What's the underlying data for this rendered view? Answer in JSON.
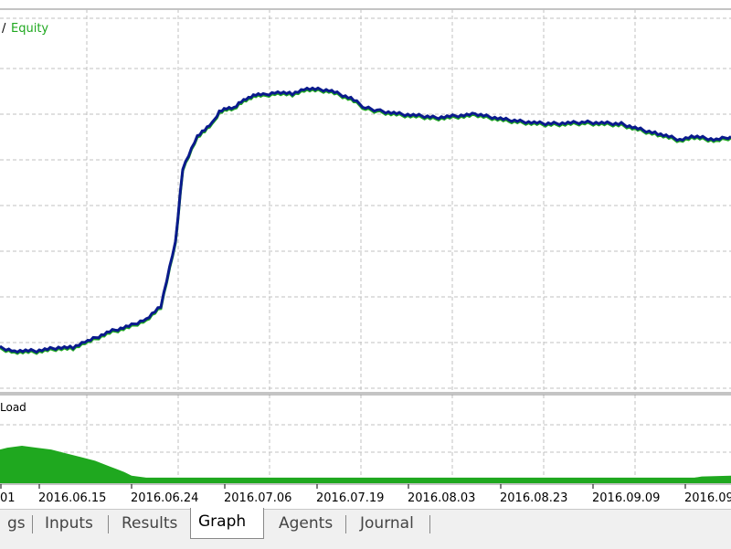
{
  "legend": {
    "prefix": "/",
    "equity_label": "Equity"
  },
  "load_label": "Load",
  "colors": {
    "balance": "#0a1a8c",
    "equity": "#1fa81f",
    "load": "#1fa81f",
    "grid": "#c0c0c0"
  },
  "tabs": [
    {
      "label": "gs",
      "active": false
    },
    {
      "label": "Inputs",
      "active": false
    },
    {
      "label": "Results",
      "active": false
    },
    {
      "label": "Graph",
      "active": true
    },
    {
      "label": "Agents",
      "active": false
    },
    {
      "label": "Journal",
      "active": false
    }
  ],
  "chart_data": {
    "type": "line",
    "title": "",
    "xlabel": "",
    "ylabel": "",
    "grid": true,
    "legend_position": "top-left",
    "x_ticks": [
      "01",
      "2016.06.15",
      "2016.06.24",
      "2016.07.06",
      "2016.07.19",
      "2016.08.03",
      "2016.08.23",
      "2016.09.09",
      "2016.09"
    ],
    "x": [
      0,
      2,
      5,
      8,
      10,
      12,
      15,
      18,
      20,
      22,
      24,
      25,
      27,
      28,
      29,
      30,
      31,
      32,
      33,
      34,
      35,
      36,
      38,
      40,
      42,
      45,
      48,
      50,
      52,
      55,
      60,
      65,
      70,
      75,
      80,
      85,
      88,
      90,
      93,
      95,
      98,
      100
    ],
    "ylim": [
      0,
      100
    ],
    "series": [
      {
        "name": "",
        "values": [
          7,
          6,
          6,
          7,
          7,
          9,
          12,
          14,
          16,
          20,
          40,
          63,
          73,
          75,
          77,
          81,
          82,
          82,
          84,
          85,
          86,
          86,
          87,
          86.5,
          88,
          87.5,
          85,
          82,
          81,
          80,
          79,
          80,
          78,
          77,
          77.5,
          77,
          75,
          74,
          72,
          73,
          72,
          73
        ]
      },
      {
        "name": "Equity",
        "values": [
          6.6,
          5.6,
          5.6,
          6.6,
          6.6,
          8.6,
          11.6,
          13.6,
          15.6,
          19.6,
          39.6,
          62.6,
          72.6,
          74.6,
          76.6,
          80.6,
          81.6,
          81.6,
          83.6,
          84.6,
          85.6,
          85.6,
          86.6,
          86.1,
          87.6,
          87.1,
          84.6,
          81.6,
          80.6,
          79.6,
          78.6,
          79.6,
          77.6,
          76.6,
          77.1,
          76.6,
          74.6,
          73.6,
          71.6,
          72.6,
          71.6,
          72.6
        ]
      }
    ],
    "load": {
      "name": "Load",
      "x": [
        0,
        1,
        3,
        5,
        7,
        9,
        11,
        13,
        15,
        17,
        18,
        20,
        25,
        30,
        90,
        95,
        96,
        100
      ],
      "values": [
        90,
        95,
        100,
        95,
        90,
        80,
        70,
        60,
        45,
        30,
        20,
        15,
        15,
        15,
        15,
        15,
        18,
        20
      ],
      "ylim": [
        0,
        100
      ]
    }
  }
}
